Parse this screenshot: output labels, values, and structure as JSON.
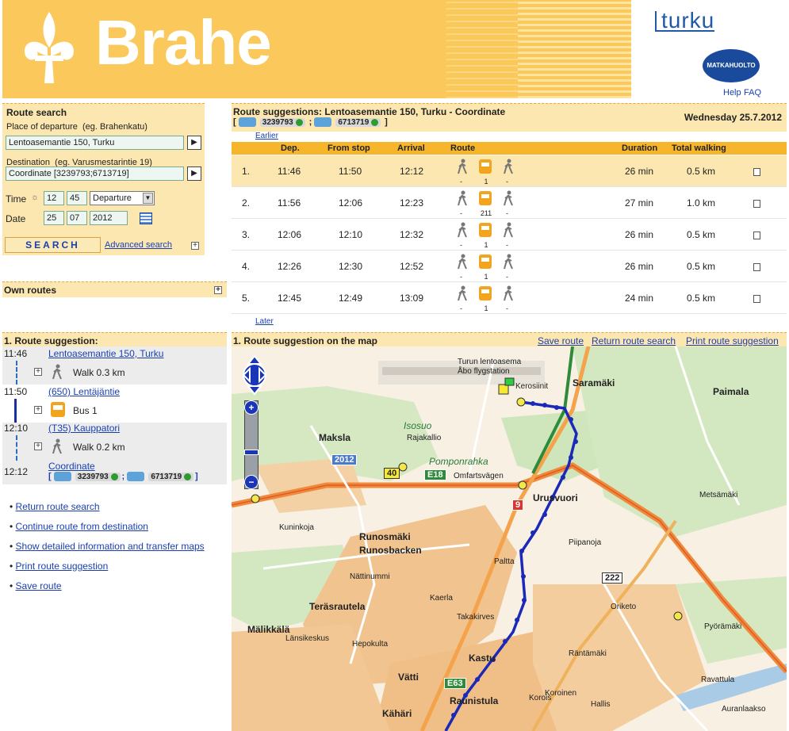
{
  "header": {
    "brand": "Brahe",
    "city_logo": "turku",
    "agency_logo": "MATKAHUOLTO",
    "help": "Help",
    "faq": "FAQ"
  },
  "search": {
    "title": "Route search",
    "departure_label": "Place of departure",
    "departure_hint": "(eg. Brahenkatu)",
    "departure_value": "Lentoasemantie 150, Turku",
    "destination_label": "Destination",
    "destination_hint": "(eg. Varusmestarintie 19)",
    "destination_value": "Coordinate [3239793;6713719]",
    "time_label": "Time",
    "hour": "12",
    "minute": "45",
    "time_mode": "Departure",
    "date_label": "Date",
    "day": "25",
    "month": "07",
    "year": "2012",
    "search_button": "SEARCH",
    "advanced_link": "Advanced search",
    "go": "▶"
  },
  "own_routes": {
    "title": "Own routes"
  },
  "results": {
    "title": "Route suggestions: Lentoasemantie 150, Turku - Coordinate",
    "coord_x": "3239793",
    "coord_y": "6713719",
    "date": "Wednesday 25.7.2012",
    "earlier": "Earlier",
    "later": "Later",
    "columns": {
      "dep": "Dep.",
      "from_stop": "From stop",
      "arrival": "Arrival",
      "route": "Route",
      "duration": "Duration",
      "walking": "Total walking"
    },
    "rows": [
      {
        "no": "1.",
        "dep": "11:46",
        "from": "11:50",
        "arr": "12:12",
        "w1": "-",
        "bus": "1",
        "w2": "-",
        "duration": "26 min",
        "walking": "0.5 km"
      },
      {
        "no": "2.",
        "dep": "11:56",
        "from": "12:06",
        "arr": "12:23",
        "w1": "-",
        "bus": "211",
        "w2": "-",
        "duration": "27 min",
        "walking": "1.0 km"
      },
      {
        "no": "3.",
        "dep": "12:06",
        "from": "12:10",
        "arr": "12:32",
        "w1": "-",
        "bus": "1",
        "w2": "-",
        "duration": "26 min",
        "walking": "0.5 km"
      },
      {
        "no": "4.",
        "dep": "12:26",
        "from": "12:30",
        "arr": "12:52",
        "w1": "-",
        "bus": "1",
        "w2": "-",
        "duration": "26 min",
        "walking": "0.5 km"
      },
      {
        "no": "5.",
        "dep": "12:45",
        "from": "12:49",
        "arr": "13:09",
        "w1": "-",
        "bus": "1",
        "w2": "-",
        "duration": "24 min",
        "walking": "0.5 km"
      }
    ]
  },
  "itinerary": {
    "title": "1. Route suggestion:",
    "t1": "11:46",
    "s1": "Lentoasemantie 150, Turku",
    "m1": "Walk 0.3 km",
    "t2": "11:50",
    "s2": "(650) Lentäjäntie",
    "m2": "Bus 1",
    "t3": "12:10",
    "s3": "(T35) Kauppatori",
    "m3": "Walk 0.2 km",
    "t4": "12:12",
    "s4": "Coordinate",
    "cx": "3239793",
    "cy": "6713719"
  },
  "actions": [
    "Return route search",
    "Continue route from destination",
    "Show detailed information and transfer maps",
    "Print route suggestion",
    "Save route"
  ],
  "map": {
    "title": "1. Route suggestion on the map",
    "save": "Save route",
    "return": "Return route search",
    "print": "Print route suggestion",
    "labels": {
      "airport": "Turun lentoasema",
      "airport_sv": "Åbo flygstation",
      "saramaki": "Saramäki",
      "paimala": "Paimala",
      "maksla": "Maksla",
      "urusvuori": "Urusvuori",
      "runosmaki": "Runosmäki",
      "runosbacken": "Runosbacken",
      "terasrautela": "Teräsrautela",
      "malikkala": "Mälikkälä",
      "kastu": "Kastu",
      "raunistula": "Raunistula",
      "vatti": "Vätti",
      "kahari": "Kähäri",
      "metsamaki": "Metsämäki",
      "oriketo": "Oriketo",
      "kerosiinit": "Kerosiinit",
      "pomponrahka": "Pomponrahka",
      "omfartsvagen": "Omfartsvägen",
      "kuninkoja": "Kuninkoja",
      "paltta": "Paltta",
      "kaerla": "Kaerla",
      "takakirves": "Takakirves",
      "rantamaki": "Räntämäki",
      "ravattula": "Ravattula",
      "hallis": "Hallis",
      "koroinen": "Koroinen",
      "korois": "Korois",
      "piipanoja": "Piipanoja",
      "lansikeskus": "Länsikeskus",
      "hepokulta": "Hepokulta",
      "isosuo": "Isosuo",
      "rajakallio": "Rajakallio",
      "nattinummi": "Nättinummi",
      "auranlaakso": "Auranlaakso",
      "pyoramaki": "Pyörämäki"
    },
    "roads": {
      "r2012": "2012",
      "r40": "40",
      "e18": "E18",
      "r222": "222",
      "e63": "E63",
      "r9": "9"
    }
  }
}
